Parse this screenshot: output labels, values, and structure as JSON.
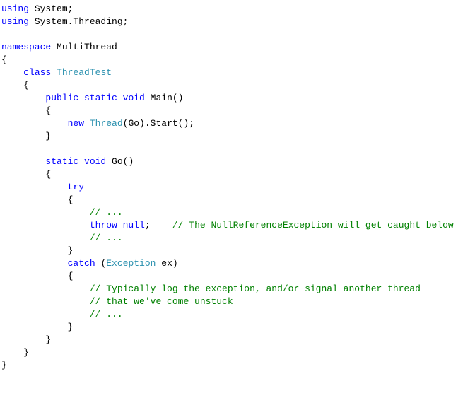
{
  "code": {
    "l1_using": "using",
    "l1_system": " System;",
    "l2_using": "using",
    "l2_rest": " System.Threading;",
    "l4_ns": "namespace",
    "l4_rest": " MultiThread",
    "l5": "{",
    "l6_indent": "    ",
    "l6_class": "class",
    "l6_space": " ",
    "l6_name": "ThreadTest",
    "l7": "    {",
    "l8_indent": "        ",
    "l8_mods": "public static void",
    "l8_rest": " Main()",
    "l9": "        {",
    "l10_indent": "            ",
    "l10_new": "new",
    "l10_space": " ",
    "l10_thread": "Thread",
    "l10_rest": "(Go).Start();",
    "l11": "        }",
    "l13_indent": "        ",
    "l13_mods": "static void",
    "l13_rest": " Go()",
    "l14": "        {",
    "l15_indent": "            ",
    "l15_try": "try",
    "l16": "            {",
    "l17_indent": "                ",
    "l17_c": "// ...",
    "l18_indent": "                ",
    "l18_throw": "throw null",
    "l18_semi": ";    ",
    "l18_c": "// The NullReferenceException will get caught below",
    "l19_indent": "                ",
    "l19_c": "// ...",
    "l20": "            }",
    "l21_indent": "            ",
    "l21_catch": "catch",
    "l21_sp": " (",
    "l21_ex": "Exception",
    "l21_rest": " ex)",
    "l22": "            {",
    "l23_indent": "                ",
    "l23_c": "// Typically log the exception, and/or signal another thread",
    "l24_indent": "                ",
    "l24_c": "// that we've come unstuck",
    "l25_indent": "                ",
    "l25_c": "// ...",
    "l26": "            }",
    "l27": "        }",
    "l28": "    }",
    "l29": "}"
  }
}
